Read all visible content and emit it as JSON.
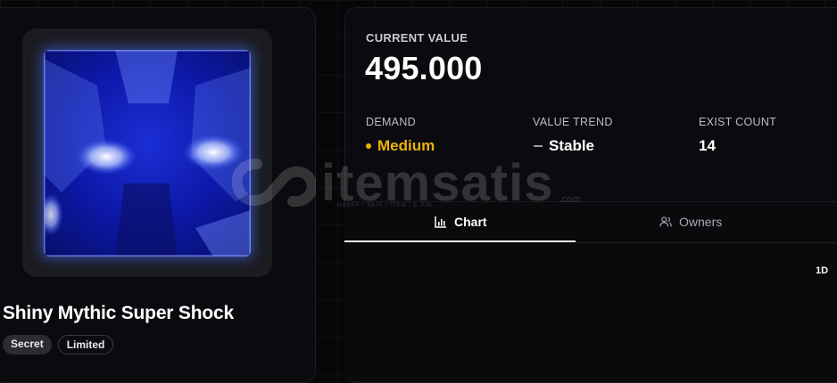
{
  "item": {
    "name": "Shiny Mythic Super Shock",
    "tags": [
      "Secret",
      "Limited"
    ],
    "image_icon": "shock-item-image"
  },
  "value": {
    "label": "CURRENT VALUE",
    "amount": "495.000"
  },
  "stats": {
    "demand": {
      "label": "DEMAND",
      "value": "Medium",
      "color": "#eab308"
    },
    "trend": {
      "label": "VALUE TREND",
      "value": "Stable"
    },
    "exist": {
      "label": "EXIST COUNT",
      "value": "14"
    }
  },
  "tabs": {
    "chart": "Chart",
    "owners": "Owners"
  },
  "chart": {
    "range": "1D"
  },
  "watermark": {
    "text": "itemsatis",
    "sub": "HESAP / SKIN / ITEM / E-PIN",
    "domain": ".com"
  }
}
